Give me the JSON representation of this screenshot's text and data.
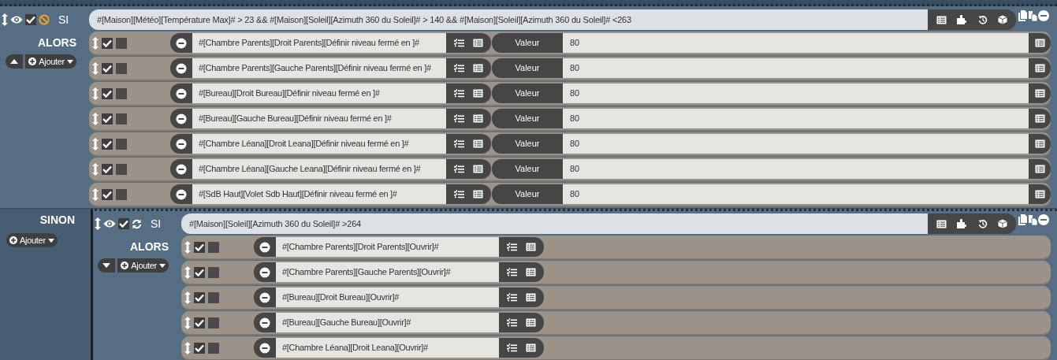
{
  "if_block": {
    "label": "SI",
    "kind": "ban",
    "enabled": true,
    "condition": "#[Maison][Météo][Température Max]# > 23 && #[Maison][Soleil][Azimuth 360 du Soleil]# > 140  &&  #[Maison][Soleil][Azimuth 360 du Soleil]# <263",
    "then": {
      "label": "ALORS",
      "expanded": true,
      "add_button": "Ajouter",
      "actions": [
        {
          "kind": "value",
          "enabled": true,
          "flagged": false,
          "command": "#[Chambre Parents][Droit Parents][Définir niveau fermé en ]#",
          "value_label": "Valeur",
          "value": "80"
        },
        {
          "kind": "value",
          "enabled": true,
          "flagged": false,
          "command": "#[Chambre Parents][Gauche Parents][Définir niveau fermé en ]#",
          "value_label": "Valeur",
          "value": "80"
        },
        {
          "kind": "value",
          "enabled": true,
          "flagged": false,
          "command": "#[Bureau][Droit Bureau][Définir niveau fermé en ]#",
          "value_label": "Valeur",
          "value": "80"
        },
        {
          "kind": "value",
          "enabled": true,
          "flagged": false,
          "command": "#[Bureau][Gauche Bureau][Définir niveau fermé en ]#",
          "value_label": "Valeur",
          "value": "80"
        },
        {
          "kind": "value",
          "enabled": true,
          "flagged": false,
          "command": "#[Chambre Léana][Droit Leana][Définir niveau fermé en ]#",
          "value_label": "Valeur",
          "value": "80"
        },
        {
          "kind": "value",
          "enabled": true,
          "flagged": false,
          "command": "#[Chambre Léana][Gauche Leana][Définir niveau fermé en ]#",
          "value_label": "Valeur",
          "value": "80"
        },
        {
          "kind": "value",
          "enabled": true,
          "flagged": false,
          "command": "#[SdB Haut][Volet Sdb Haut][Définir niveau fermé en ]#",
          "value_label": "Valeur",
          "value": "80"
        }
      ]
    }
  },
  "else": {
    "label": "SINON",
    "add_button": "Ajouter",
    "if_block": {
      "label": "SI",
      "kind": "repeat",
      "enabled": true,
      "condition": "#[Maison][Soleil][Azimuth 360 du Soleil]# >264",
      "then": {
        "label": "ALORS",
        "expanded": false,
        "add_button": "Ajouter",
        "actions": [
          {
            "kind": "plain",
            "enabled": true,
            "flagged": false,
            "command": "#[Chambre Parents][Droit Parents][Ouvrir]#"
          },
          {
            "kind": "plain",
            "enabled": true,
            "flagged": false,
            "command": "#[Chambre Parents][Gauche Parents][Ouvrir]#"
          },
          {
            "kind": "plain",
            "enabled": true,
            "flagged": false,
            "command": "#[Bureau][Droit Bureau][Ouvrir]#"
          },
          {
            "kind": "plain",
            "enabled": true,
            "flagged": false,
            "command": "#[Bureau][Gauche Bureau][Ouvrir]#"
          },
          {
            "kind": "plain",
            "enabled": true,
            "flagged": false,
            "command": "#[Chambre Léana][Droit Leana][Ouvrir]#"
          }
        ]
      }
    }
  }
}
